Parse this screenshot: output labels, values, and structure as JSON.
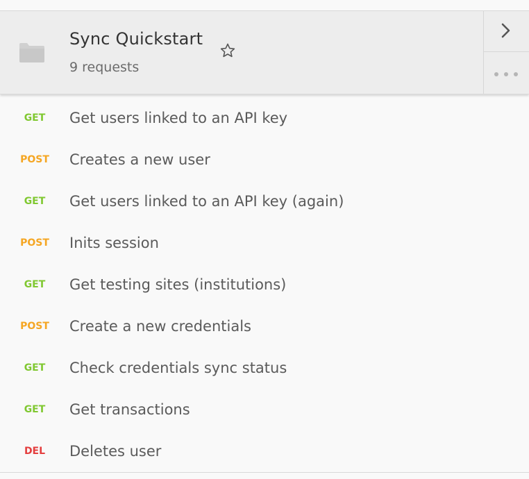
{
  "collection": {
    "title": "Sync Quickstart",
    "count": "9 requests",
    "folder_icon": "folder-icon",
    "star_icon": "star-outline-icon",
    "expand_icon": "chevron-right-icon",
    "more_icon": "more-horizontal-icon"
  },
  "colors": {
    "get": "#80c831",
    "post": "#f5a623",
    "del": "#e43e3e",
    "header_bg": "#ededed",
    "list_bg": "#f9f9f9"
  },
  "requests": [
    {
      "method": "GET",
      "name": "Get users linked to an API key"
    },
    {
      "method": "POST",
      "name": "Creates a new user"
    },
    {
      "method": "GET",
      "name": "Get users linked to an API key (again)"
    },
    {
      "method": "POST",
      "name": "Inits session"
    },
    {
      "method": "GET",
      "name": "Get testing sites (institutions)"
    },
    {
      "method": "POST",
      "name": "Create a new credentials"
    },
    {
      "method": "GET",
      "name": "Check credentials sync status"
    },
    {
      "method": "GET",
      "name": "Get transactions"
    },
    {
      "method": "DEL",
      "name": "Deletes user"
    }
  ]
}
